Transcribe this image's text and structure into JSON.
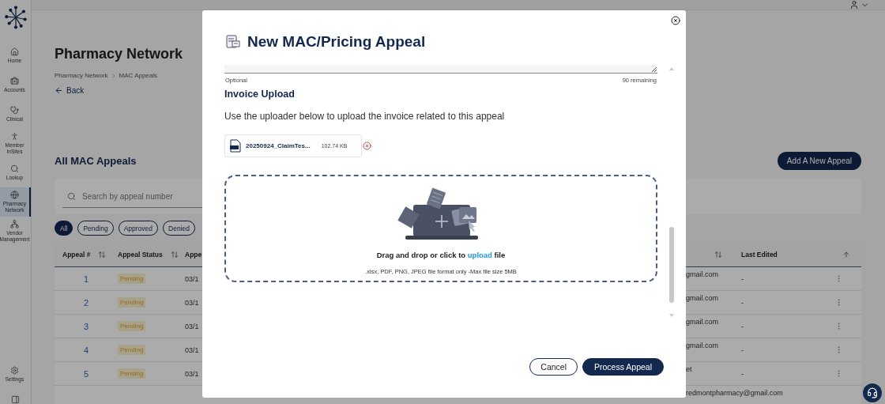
{
  "sidebar": {
    "items": [
      {
        "kind": "home",
        "label": "Home",
        "selected": false
      },
      {
        "kind": "accounts",
        "label": "Accounts",
        "selected": false
      },
      {
        "kind": "clinical",
        "label": "Clinical",
        "selected": false
      },
      {
        "kind": "member",
        "label": "Member InSites",
        "selected": false
      },
      {
        "kind": "lookup",
        "label": "Lookup",
        "selected": false
      },
      {
        "kind": "pharmacy",
        "label": "Pharmacy Network",
        "selected": true
      },
      {
        "kind": "vendor",
        "label": "Vendor Management",
        "selected": false
      }
    ],
    "settings": {
      "label": "Settings"
    }
  },
  "page": {
    "title": "Pharmacy Network",
    "breadcrumb": [
      "Pharmacy Network",
      "MAC Appeals"
    ],
    "back": "Back",
    "section_title": "All MAC Appeals",
    "add_button": "Add A New Appeal",
    "search": {
      "placeholder": "Search by appeal number"
    },
    "filters": [
      {
        "label": "All",
        "selected": true
      },
      {
        "label": "Pending",
        "selected": false
      },
      {
        "label": "Approved",
        "selected": false
      },
      {
        "label": "Denied",
        "selected": false
      }
    ]
  },
  "table": {
    "columns": [
      {
        "label": "Appeal #",
        "sorted": false
      },
      {
        "label": "Appeal Status",
        "sorted": false
      },
      {
        "label": "Appe"
      },
      {
        "sorted": false
      },
      {
        "label": "Last Edited",
        "sorted": true
      }
    ],
    "rows": [
      {
        "appeal_number": "1",
        "appeal_status": "Pending",
        "column_3": "03/1",
        "column_4": "gmail.com",
        "last_edited": "-"
      },
      {
        "appeal_number": "2",
        "appeal_status": "Pending",
        "column_3": "03/1",
        "column_4": "gmail.com",
        "last_edited": "-"
      },
      {
        "appeal_number": "3",
        "appeal_status": "Pending",
        "column_3": "03/1",
        "column_4": "gmail.com",
        "last_edited": "-"
      },
      {
        "appeal_number": "4",
        "appeal_status": "Pending",
        "column_3": "03/1",
        "column_4": "gmail.com",
        "last_edited": "-"
      },
      {
        "appeal_number": "5",
        "appeal_status": "Pending",
        "column_3": "03/1",
        "column_4": "et",
        "last_edited": "-"
      },
      {
        "column_4": "redmontpharmacy@gmail.com"
      }
    ]
  },
  "modal": {
    "title": "New MAC/Pricing Appeal",
    "notes_field": {
      "hint": "Optional",
      "remaining": "90 remaining"
    },
    "section_title": "Invoice Upload",
    "description": "Use the uploader below to upload the invoice related to this appeal",
    "file": {
      "name": "20250924_ClaimTes...",
      "size": "102.74 KB"
    },
    "dropzone": {
      "prompt": "Drag and drop or click to ",
      "link": "upload",
      "prompt_end": " file",
      "formats": ".xlsx, PDF, PNG, JPEG file format only -Max file size 5MB"
    },
    "buttons": [
      {
        "kind": "secondary",
        "label": "Cancel"
      },
      {
        "kind": "primary",
        "label": "Process Appeal"
      }
    ]
  }
}
